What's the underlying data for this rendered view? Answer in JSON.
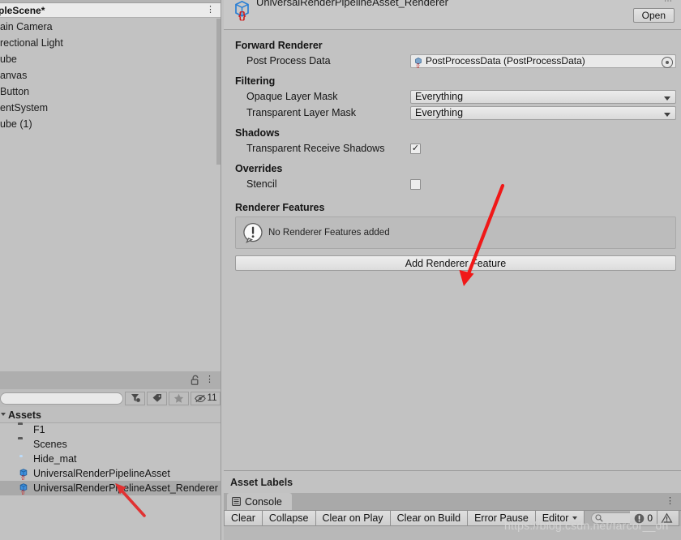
{
  "colors": {
    "window_bg": "#c2c2c2",
    "panel_bg": "#bdbdbd",
    "selection": "#a9a9a9",
    "accent_annotation": "#f01818",
    "urp_icon_blue": "#2a7fd4",
    "material_icon_blue": "#1d7fe0",
    "folder_icon": "#5a5a5a"
  },
  "hierarchy": {
    "scene_name": "pleScene*",
    "kebab_icon": "kebab-menu-icon",
    "items": [
      {
        "label": "ain Camera"
      },
      {
        "label": "rectional Light"
      },
      {
        "label": "ube"
      },
      {
        "label": "anvas"
      },
      {
        "label": "Button"
      },
      {
        "label": "entSystem"
      },
      {
        "label": "ube (1)"
      }
    ]
  },
  "project": {
    "lock_icon": "lock-open-icon",
    "kebab_icon": "kebab-menu-icon",
    "search": {
      "value": "",
      "placeholder": ""
    },
    "toolbar_buttons": [
      {
        "name": "filter-by-type-icon",
        "label": ""
      },
      {
        "name": "filter-by-label-icon",
        "label": ""
      },
      {
        "name": "favorites-star-icon",
        "label": ""
      },
      {
        "name": "hidden-packages-icon",
        "label": "11"
      }
    ],
    "root_label": "Assets",
    "assets": [
      {
        "label": "F1",
        "icon": "folder-icon",
        "selected": false
      },
      {
        "label": "Scenes",
        "icon": "folder-icon",
        "selected": false
      },
      {
        "label": "Hide_mat",
        "icon": "material-icon",
        "selected": false
      },
      {
        "label": "UniversalRenderPipelineAsset",
        "icon": "urp-asset-icon",
        "selected": false
      },
      {
        "label": "UniversalRenderPipelineAsset_Renderer",
        "icon": "urp-asset-icon",
        "selected": true
      }
    ]
  },
  "inspector": {
    "title": "UniversalRenderPipelineAsset_Renderer",
    "asset_icon": "urp-renderer-asset-icon",
    "open_button": "Open",
    "window_controls": "⋯",
    "sections": {
      "forward_renderer": {
        "title": "Forward Renderer",
        "post_process_data": {
          "label": "Post Process Data",
          "value": "PostProcessData (PostProcessData)",
          "icon": "scriptable-object-icon",
          "picker_icon": "object-picker-icon"
        }
      },
      "filtering": {
        "title": "Filtering",
        "opaque_layer_mask": {
          "label": "Opaque Layer Mask",
          "value": "Everything"
        },
        "transparent_layer_mask": {
          "label": "Transparent Layer Mask",
          "value": "Everything"
        }
      },
      "shadows": {
        "title": "Shadows",
        "transparent_receive_shadows": {
          "label": "Transparent Receive Shadows",
          "checked": true,
          "mark": "✓"
        }
      },
      "overrides": {
        "title": "Overrides",
        "stencil": {
          "label": "Stencil",
          "checked": false,
          "mark": ""
        }
      },
      "renderer_features": {
        "title": "Renderer Features",
        "empty_message": "No Renderer Features added",
        "info_icon": "exclamation-help-icon",
        "add_button": "Add Renderer Feature"
      }
    }
  },
  "asset_labels": {
    "title": "Asset Labels"
  },
  "console": {
    "tab_label": "Console",
    "tab_icon": "console-icon",
    "kebab_icon": "kebab-menu-icon",
    "buttons": [
      {
        "label": "Clear",
        "has_arrow": false
      },
      {
        "label": "Collapse",
        "has_arrow": false
      },
      {
        "label": "Clear on Play",
        "has_arrow": false
      },
      {
        "label": "Clear on Build",
        "has_arrow": false
      },
      {
        "label": "Error Pause",
        "has_arrow": false
      },
      {
        "label": "Editor",
        "has_arrow": true
      }
    ],
    "search": {
      "value": "",
      "placeholder": "",
      "icon": "search-icon"
    },
    "counts": [
      {
        "icon": "error-icon",
        "value": "0"
      },
      {
        "icon": "warning-icon",
        "value": ""
      }
    ]
  },
  "annotations": {
    "arrow_to_add_renderer_feature": "arrow-pointing-to-add-renderer-feature",
    "arrow_to_selected_asset": "arrow-pointing-to-selected-asset"
  },
  "watermark": {
    "text": "https://blog.csdn.net/farcor__oh"
  }
}
